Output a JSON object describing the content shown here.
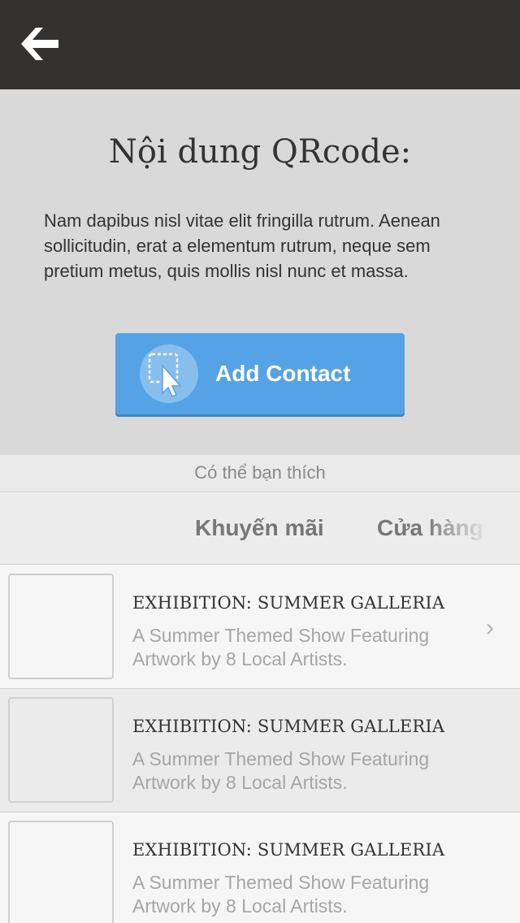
{
  "header": {
    "back_icon": "arrow-left-icon"
  },
  "qr": {
    "title": "Nội dung QRcode:",
    "body": "Nam dapibus nisl vitae elit fringilla rutrum. Aenean sollicitudin, erat a elementum rutrum, neque sem pretium metus, quis mollis nisl nunc et massa.",
    "button_label": "Add Contact",
    "button_icon": "select-pointer-icon",
    "button_color": "#55a3e6"
  },
  "suggest": {
    "label": "Có thể bạn thích"
  },
  "tabs": [
    {
      "label": "Khuyến mãi"
    },
    {
      "label": "Cửa hàng"
    }
  ],
  "items": [
    {
      "title": "EXHIBITION: SUMMER GALLERIA",
      "desc": "A Summer Themed Show Featuring Artwork by 8 Local Artists.",
      "chevron": "›"
    },
    {
      "title": "EXHIBITION: SUMMER GALLERIA",
      "desc": "A Summer Themed Show Featuring Artwork by 8 Local Artists."
    },
    {
      "title": "EXHIBITION: SUMMER GALLERIA",
      "desc": "A Summer Themed Show Featuring Artwork by 8 Local Artists."
    }
  ]
}
